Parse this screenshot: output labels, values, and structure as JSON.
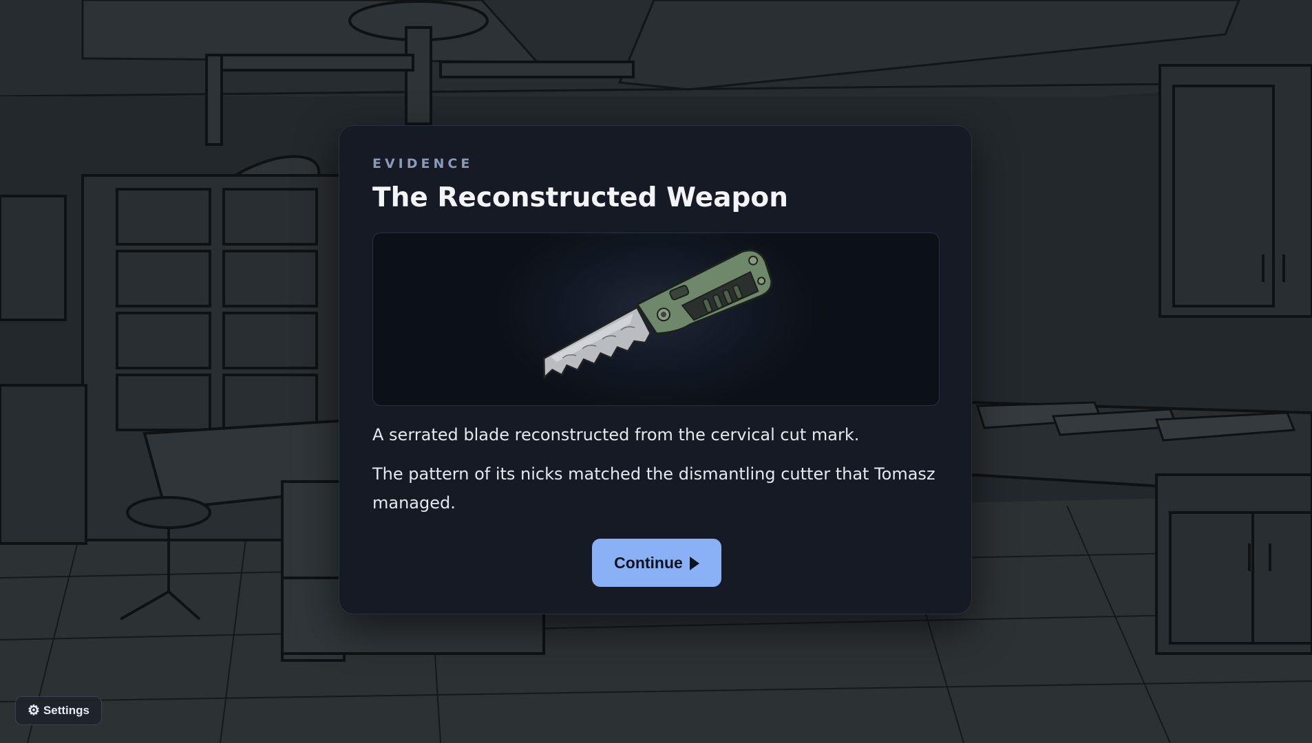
{
  "card": {
    "kicker": "EVIDENCE",
    "title": "The Reconstructed Weapon",
    "image_alt": "serrated knife",
    "description_1": "A serrated blade reconstructed from the cervical cut mark.",
    "description_2": "The pattern of its nicks matched the dismantling cutter that Tomasz managed.",
    "continue_label": "Continue"
  },
  "settings": {
    "label": "Settings",
    "icon": "gear-icon"
  },
  "colors": {
    "accent": "#8ab0f6",
    "card_bg": "#151a24",
    "kicker": "#8a9ab8"
  }
}
